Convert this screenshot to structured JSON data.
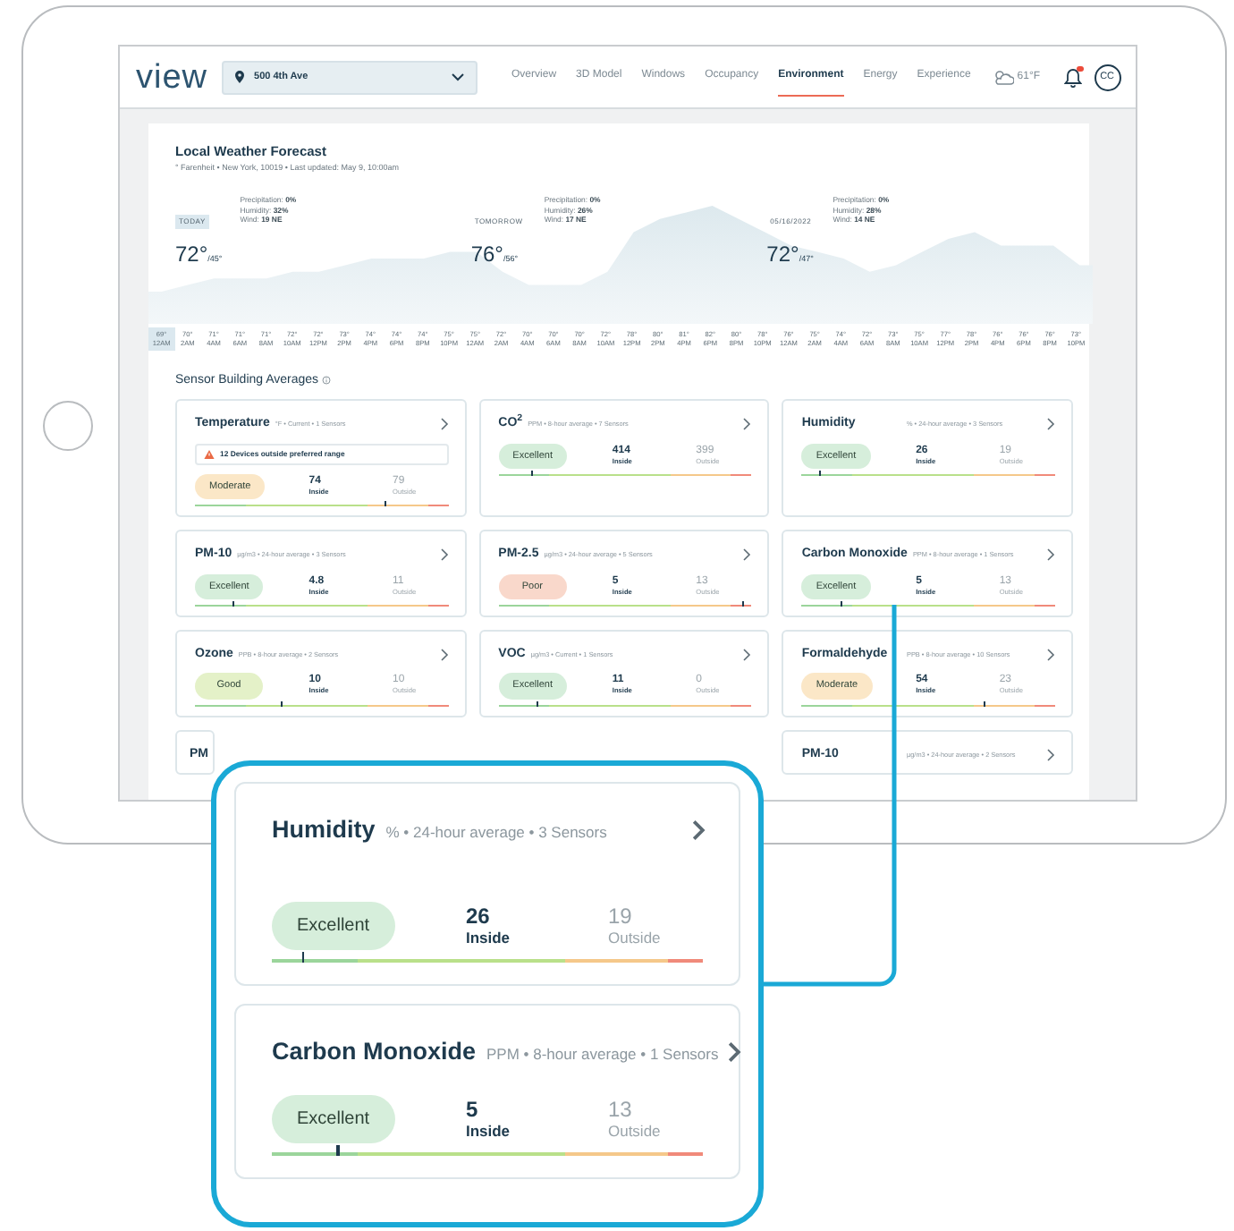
{
  "nav": {
    "logo": "view",
    "location": "500 4th Ave",
    "links": [
      {
        "label": "Overview",
        "selected": false
      },
      {
        "label": "3D Model",
        "selected": false
      },
      {
        "label": "Windows",
        "selected": false
      },
      {
        "label": "Occupancy",
        "selected": false
      },
      {
        "label": "Environment",
        "selected": true
      },
      {
        "label": "Energy",
        "selected": false
      },
      {
        "label": "Experience",
        "selected": false
      }
    ],
    "weather": "61°F",
    "unread": true,
    "avatar": "CC"
  },
  "forecast": {
    "title": "Local Weather Forecast",
    "subtitle": "° Farenheit • New York, 10019 • Last updated: May 9, 10:00am",
    "days": [
      {
        "label": "TODAY",
        "selected": true,
        "high": "72°",
        "low": "/45°",
        "details": [
          {
            "label": "Precipitation:",
            "value": "0%"
          },
          {
            "label": "Humidity:",
            "value": "32%"
          },
          {
            "label": "Wind:",
            "value": "19 NE"
          }
        ]
      },
      {
        "label": "TOMORROW",
        "selected": false,
        "high": "76°",
        "low": "/56°",
        "details": [
          {
            "label": "Precipitation:",
            "value": "0%"
          },
          {
            "label": "Humidity:",
            "value": "26%"
          },
          {
            "label": "Wind:",
            "value": "17 NE"
          }
        ]
      },
      {
        "label": "05/16/2022",
        "selected": false,
        "high": "72°",
        "low": "/47°",
        "details": [
          {
            "label": "Precipitation:",
            "value": "0%"
          },
          {
            "label": "Humidity:",
            "value": "28%"
          },
          {
            "label": "Wind:",
            "value": "14 NE"
          }
        ]
      }
    ],
    "hours": [
      {
        "temp": "69°",
        "time": "12AM",
        "past": true
      },
      {
        "temp": "70°",
        "time": "2AM",
        "past": false
      },
      {
        "temp": "71°",
        "time": "4AM",
        "past": false
      },
      {
        "temp": "71°",
        "time": "6AM",
        "past": false
      },
      {
        "temp": "71°",
        "time": "8AM",
        "past": false
      },
      {
        "temp": "72°",
        "time": "10AM",
        "past": false
      },
      {
        "temp": "72°",
        "time": "12PM",
        "past": false
      },
      {
        "temp": "73°",
        "time": "2PM",
        "past": false
      },
      {
        "temp": "74°",
        "time": "4PM",
        "past": false
      },
      {
        "temp": "74°",
        "time": "6PM",
        "past": false
      },
      {
        "temp": "74°",
        "time": "8PM",
        "past": false
      },
      {
        "temp": "75°",
        "time": "10PM",
        "past": false
      },
      {
        "temp": "75°",
        "time": "12AM",
        "past": false
      },
      {
        "temp": "72°",
        "time": "2AM",
        "past": false
      },
      {
        "temp": "70°",
        "time": "4AM",
        "past": false
      },
      {
        "temp": "70°",
        "time": "6AM",
        "past": false
      },
      {
        "temp": "70°",
        "time": "8AM",
        "past": false
      },
      {
        "temp": "72°",
        "time": "10AM",
        "past": false
      },
      {
        "temp": "78°",
        "time": "12PM",
        "past": false
      },
      {
        "temp": "80°",
        "time": "2PM",
        "past": false
      },
      {
        "temp": "81°",
        "time": "4PM",
        "past": false
      },
      {
        "temp": "82°",
        "time": "6PM",
        "past": false
      },
      {
        "temp": "80°",
        "time": "8PM",
        "past": false
      },
      {
        "temp": "78°",
        "time": "10PM",
        "past": false
      },
      {
        "temp": "76°",
        "time": "12AM",
        "past": false
      },
      {
        "temp": "75°",
        "time": "2AM",
        "past": false
      },
      {
        "temp": "74°",
        "time": "4AM",
        "past": false
      },
      {
        "temp": "72°",
        "time": "6AM",
        "past": false
      },
      {
        "temp": "73°",
        "time": "8AM",
        "past": false
      },
      {
        "temp": "75°",
        "time": "10AM",
        "past": false
      },
      {
        "temp": "77°",
        "time": "12PM",
        "past": false
      },
      {
        "temp": "78°",
        "time": "2PM",
        "past": false
      },
      {
        "temp": "76°",
        "time": "4PM",
        "past": false
      },
      {
        "temp": "76°",
        "time": "6PM",
        "past": false
      },
      {
        "temp": "76°",
        "time": "8PM",
        "past": false
      },
      {
        "temp": "73°",
        "time": "10PM",
        "past": false
      }
    ]
  },
  "sensors": {
    "title": "Sensor Building Averages",
    "cards": [
      {
        "title": "Temperature",
        "meta": "°F • Current • 1 Sensors",
        "alert": "12 Devices outside preferred range",
        "status": "Moderate",
        "color": "#fbe7c7",
        "inside": "74",
        "inside_label": "Inside",
        "outside": "79",
        "outside_label": "Outside",
        "level": 0.75
      },
      {
        "title": "CO$^{2}$",
        "meta": "PPM • 8-hour average • 7 Sensors",
        "status": "Excellent",
        "color": "#d6eedb",
        "inside": "414",
        "inside_label": "Inside",
        "outside": "399",
        "outside_label": "Outside",
        "level": 0.13
      },
      {
        "title": "Humidity",
        "meta": "% • 24-hour average • 3 Sensors",
        "status": "Excellent",
        "color": "#d6eedb",
        "inside": "26",
        "inside_label": "Inside",
        "outside": "19",
        "outside_label": "Outside",
        "level": 0.07
      },
      {
        "title": "PM-10",
        "meta": "µg/m3 • 24-hour average • 3 Sensors",
        "status": "Excellent",
        "color": "#d6eedb",
        "inside": "4.8",
        "inside_label": "Inside",
        "outside": "11",
        "outside_label": "Outside",
        "level": 0.15
      },
      {
        "title": "PM-2.5",
        "meta": "µg/m3 • 24-hour average • 5 Sensors",
        "status": "Poor",
        "color": "#f9d8cb",
        "inside": "5",
        "inside_label": "Inside",
        "outside": "13",
        "outside_label": "Outside",
        "level": 0.96
      },
      {
        "title": "Carbon Monoxide",
        "meta": "PPM • 8-hour average • 1 Sensors",
        "status": "Excellent",
        "color": "#d6eedb",
        "inside": "5",
        "inside_label": "Inside",
        "outside": "13",
        "outside_label": "Outside",
        "level": 0.15
      },
      {
        "title": "Ozone",
        "meta": "PPB • 8-hour average • 2 Sensors",
        "status": "Good",
        "color": "#e4f1c8",
        "inside": "10",
        "inside_label": "Inside",
        "outside": "10",
        "outside_label": "Outside",
        "level": 0.34
      },
      {
        "title": "VOC",
        "meta": "µg/m3 • Current • 1 Sensors",
        "status": "Excellent",
        "color": "#d6eedb",
        "inside": "11",
        "inside_label": "Inside",
        "outside": "0",
        "outside_label": "Outside",
        "level": 0.15
      },
      {
        "title": "Formaldehyde",
        "meta": "PPB • 8-hour average • 10 Sensors",
        "status": "Moderate",
        "color": "#fbe7c7",
        "inside": "54",
        "inside_label": "Inside",
        "outside": "23",
        "outside_label": "Outside",
        "level": 0.72
      },
      {
        "title": "PM"
      },
      {
        "title": "PM-10",
        "meta": "µg/m3 • 24-hour average • 2 Sensors"
      }
    ]
  },
  "callout": {
    "cards": [
      {
        "title": "Humidity",
        "meta": "% • 24-hour average • 3 Sensors",
        "status": "Excellent",
        "color": "#d6eedb",
        "inside": "26",
        "inside_label": "Inside",
        "outside": "19",
        "outside_label": "Outside",
        "level": 0.07
      },
      {
        "title": "Carbon Monoxide",
        "meta": "PPM • 8-hour average • 1 Sensors",
        "status": "Excellent",
        "color": "#d6eedb",
        "inside": "5",
        "inside_label": "Inside",
        "outside": "13",
        "outside_label": "Outside",
        "level": 0.15
      }
    ]
  }
}
